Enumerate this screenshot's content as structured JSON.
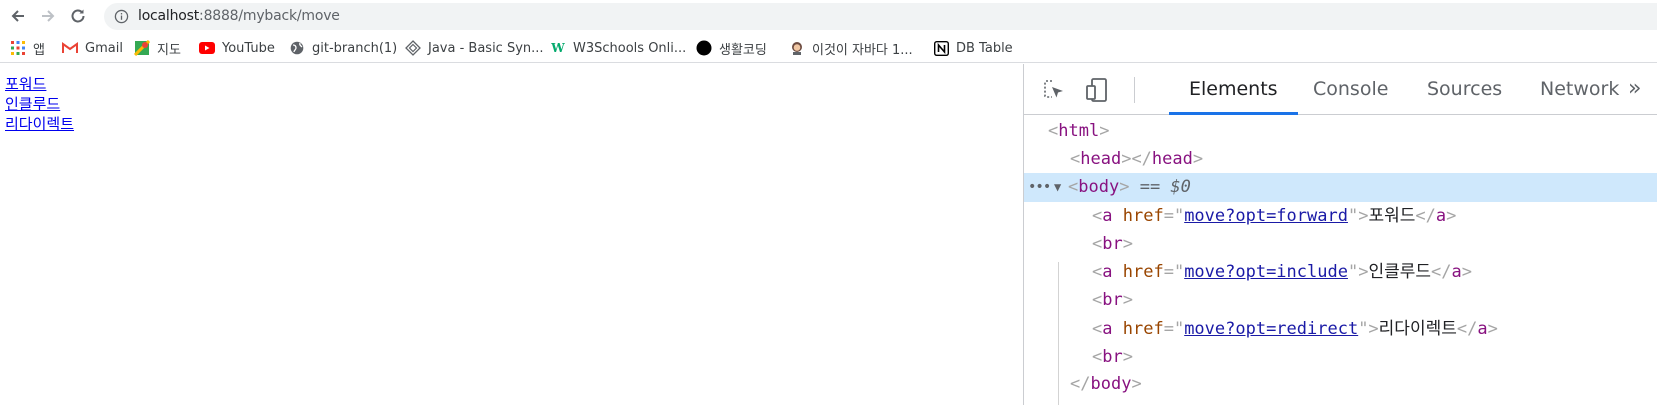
{
  "browser": {
    "url_host": "localhost",
    "url_path": ":8888/myback/move"
  },
  "bookmarks": [
    {
      "label": "앱",
      "icon": "apps-grid-icon"
    },
    {
      "label": "Gmail",
      "icon": "gmail-icon"
    },
    {
      "label": "지도",
      "icon": "maps-icon"
    },
    {
      "label": "YouTube",
      "icon": "youtube-icon"
    },
    {
      "label": "git-branch(1)",
      "icon": "globe-icon"
    },
    {
      "label": "Java - Basic Syn...",
      "icon": "diamond-icon"
    },
    {
      "label": "W3Schools Onli...",
      "icon": "w3schools-icon"
    },
    {
      "label": "생활코딩",
      "icon": "black-circle-icon"
    },
    {
      "label": "이것이 자바다 1...",
      "icon": "avatar-icon"
    },
    {
      "label": "DB Table",
      "icon": "notion-icon"
    }
  ],
  "page": {
    "links": [
      "포워드",
      "인클루드",
      "리다이렉트"
    ]
  },
  "devtools": {
    "tabs": [
      "Elements",
      "Console",
      "Sources",
      "Network"
    ],
    "active_tab": "Elements",
    "more": "»",
    "tree": {
      "html_open": "html",
      "head": "head",
      "body": "body",
      "selected_marker": "== $0",
      "attr_name": "href",
      "links": [
        {
          "href": "move?opt=forward",
          "text": "포워드"
        },
        {
          "href": "move?opt=include",
          "text": "인클루드"
        },
        {
          "href": "move?opt=redirect",
          "text": "리다이렉트"
        }
      ],
      "br": "br",
      "body_close": "body"
    }
  },
  "colors": {
    "link": "#0000ee",
    "devtools_accent": "#1a73e8",
    "selected_row": "#cfe8fc",
    "tag": "#881280",
    "attr": "#994500",
    "attr_value": "#1a1aa6"
  }
}
